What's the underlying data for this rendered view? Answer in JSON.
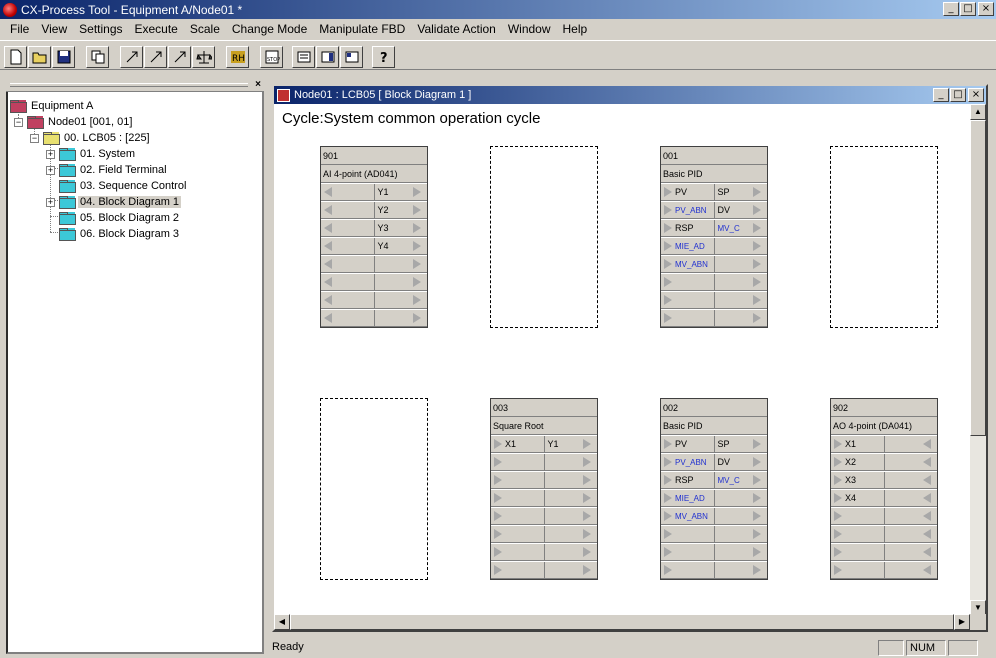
{
  "window": {
    "title": "CX-Process Tool - Equipment A/Node01 *"
  },
  "menu": [
    "File",
    "View",
    "Settings",
    "Execute",
    "Scale",
    "Change Mode",
    "Manipulate FBD",
    "Validate Action",
    "Window",
    "Help"
  ],
  "toolbar": {
    "icons": [
      "new-icon",
      "open-icon",
      "save-icon",
      "copy-icon",
      "arrow-1-icon",
      "arrow-2-icon",
      "arrow-3-icon",
      "scale-icon",
      "rh-icon",
      "stop-icon",
      "view-1-icon",
      "view-2-icon",
      "view-3-icon",
      "help-icon"
    ]
  },
  "tree": {
    "root": "Equipment A",
    "node": "Node01 [001, 01]",
    "lcb": "00. LCB05 : [225]",
    "items": [
      "01. System",
      "02. Field Terminal",
      "03. Sequence Control",
      "04. Block Diagram 1",
      "05. Block Diagram 2",
      "06. Block Diagram 3"
    ]
  },
  "diagram": {
    "title": "Node01 : LCB05  [ Block Diagram 1 ]",
    "cycle": "Cycle:System common operation cycle",
    "blocks": {
      "b901": {
        "num": "901",
        "name": "AI 4-point (AD041)",
        "rows": [
          [
            "",
            "Y1"
          ],
          [
            "",
            "Y2"
          ],
          [
            "",
            "Y3"
          ],
          [
            "",
            "Y4"
          ],
          [
            "",
            ""
          ],
          [
            "",
            ""
          ],
          [
            "",
            ""
          ],
          [
            "",
            ""
          ]
        ]
      },
      "b001": {
        "num": "001",
        "name": "Basic PID",
        "rows": [
          [
            "PV",
            "SP"
          ],
          [
            "PV_ABN",
            "DV"
          ],
          [
            "RSP",
            "MV_C"
          ],
          [
            "MIE_AD",
            ""
          ],
          [
            "MV_ABN",
            ""
          ],
          [
            "",
            ""
          ],
          [
            "",
            ""
          ],
          [
            "",
            ""
          ]
        ]
      },
      "b003": {
        "num": "003",
        "name": "Square Root",
        "rows": [
          [
            "X1",
            "Y1"
          ],
          [
            "",
            ""
          ],
          [
            "",
            ""
          ],
          [
            "",
            ""
          ],
          [
            "",
            ""
          ],
          [
            "",
            ""
          ],
          [
            "",
            ""
          ],
          [
            "",
            ""
          ]
        ]
      },
      "b002": {
        "num": "002",
        "name": "Basic PID",
        "rows": [
          [
            "PV",
            "SP"
          ],
          [
            "PV_ABN",
            "DV"
          ],
          [
            "RSP",
            "MV_C"
          ],
          [
            "MIE_AD",
            ""
          ],
          [
            "MV_ABN",
            ""
          ],
          [
            "",
            ""
          ],
          [
            "",
            ""
          ],
          [
            "",
            ""
          ]
        ]
      },
      "b902": {
        "num": "902",
        "name": "AO 4-point (DA041)",
        "rows": [
          [
            "X1",
            ""
          ],
          [
            "X2",
            ""
          ],
          [
            "X3",
            ""
          ],
          [
            "X4",
            ""
          ],
          [
            "",
            ""
          ],
          [
            "",
            ""
          ],
          [
            "",
            ""
          ],
          [
            "",
            ""
          ]
        ]
      }
    }
  },
  "status": {
    "text": "Ready",
    "num": "NUM"
  }
}
